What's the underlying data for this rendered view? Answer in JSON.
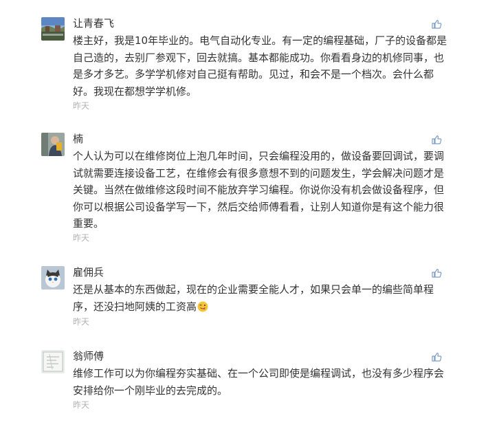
{
  "comments": [
    {
      "author": "让青春飞",
      "text": "楼主好，我是10年毕业的。电气自动化专业。有一定的编程基础，厂子的设备都是自己造的，去别厂参观下，回去就搞。基本都能成功。你看看身边的机修同事，也是多才多艺。多学学机修对自己挺有帮助。见过，和会不是一个档次。会什么都好。我现在都想学学机修。",
      "time": "昨天",
      "avatar_icon": "landscape-photo-avatar",
      "like_icon": "thumbs-up-icon"
    },
    {
      "author": "楠",
      "text": "个人认为可以在维修岗位上泡几年时间，只会编程没用的，做设备要回调试，要调试就需要连接设备工艺，在维修会有很多意想不到的问题发生，学会解决问题才是关键。当然在做维修这段时间不能放弃学习编程。你说你没有机会做设备程序，但你可以根据公司设备学写一下，然后交给师傅看看，让别人知道你是有这个能力很重要。",
      "time": "昨天",
      "avatar_icon": "person-photo-avatar",
      "like_icon": "thumbs-up-icon"
    },
    {
      "author": "雇佣兵",
      "text": "还是从基本的东西做起，现在的企业需要全能人才，如果只会单一的编些简单程序，还没扫地阿姨的工资高",
      "emoji": "winking-tongue-emoji",
      "time": "昨天",
      "avatar_icon": "cat-photo-avatar",
      "like_icon": "thumbs-up-icon"
    },
    {
      "author": "翁师傅",
      "text": "维修工作可以为你编程夯实基础、在一个公司即使是编程调试，也没有多少程序会安排给你一个刚毕业的去完成的。",
      "time": "昨天",
      "avatar_icon": "sketch-photo-avatar",
      "like_icon": "thumbs-up-icon"
    }
  ],
  "colors": {
    "text": "#333333",
    "time": "#b2b2b2",
    "like_icon": "#7a9cc6"
  }
}
